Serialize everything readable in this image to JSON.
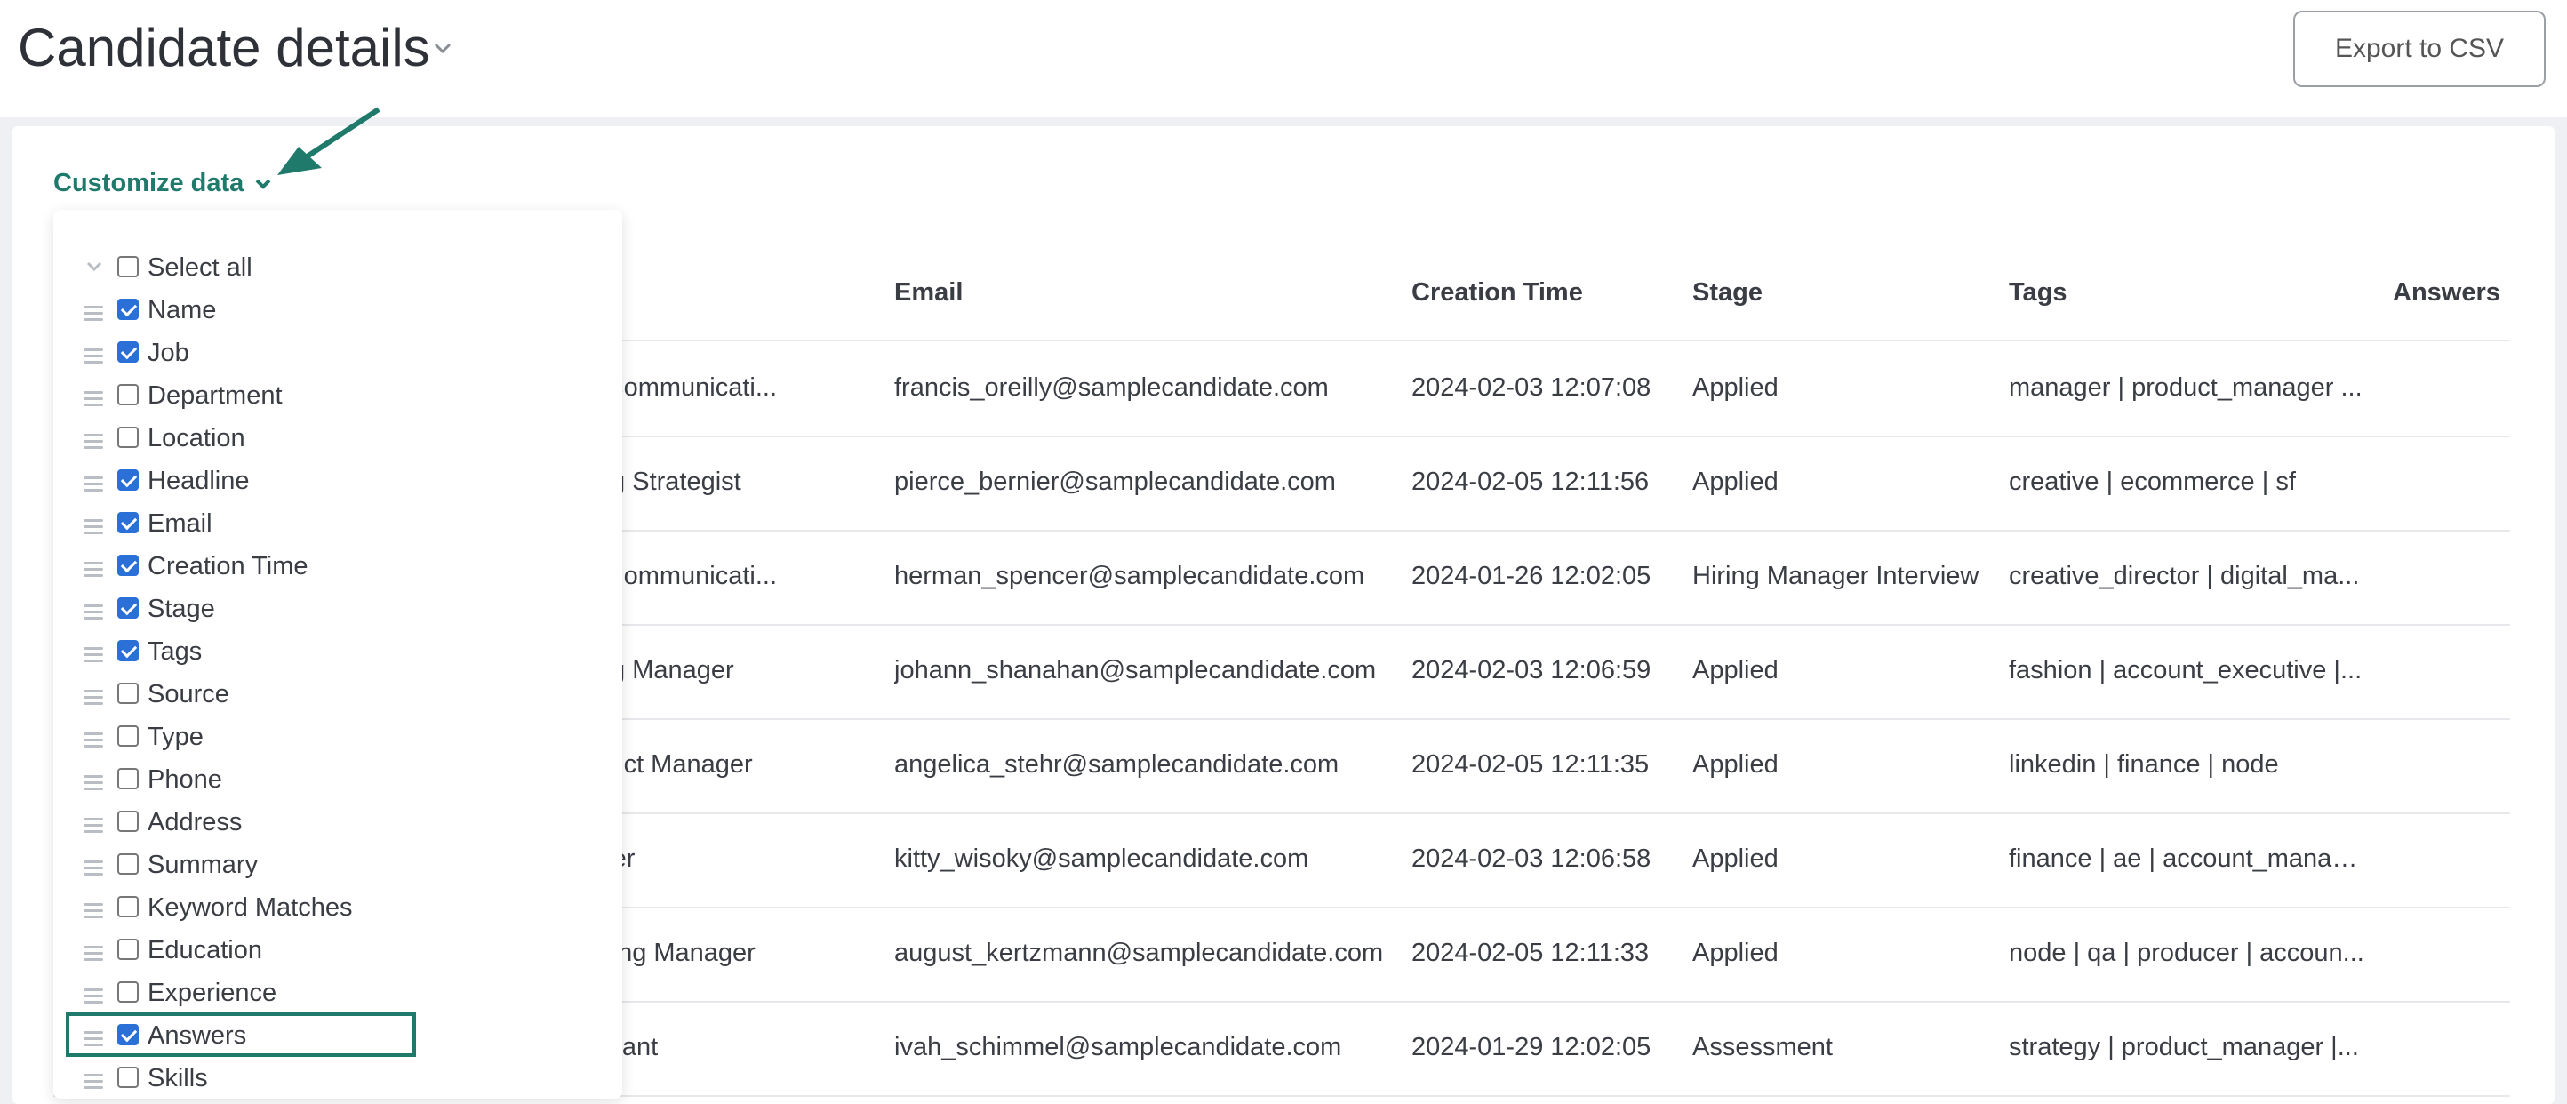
{
  "header": {
    "title": "Candidate details",
    "export_label": "Export to CSV"
  },
  "customize": {
    "label": "Customize data"
  },
  "columns": [
    "Email",
    "Creation Time",
    "Stage",
    "Tags",
    "Answers"
  ],
  "rows": [
    {
      "job": "g and Communicati...",
      "email": "francis_oreilly@samplecandidate.com",
      "time": "2024-02-03 12:07:08",
      "stage": "Applied",
      "tags": "manager | product_manager ..."
    },
    {
      "job": "arketing Strategist",
      "email": "pierce_bernier@samplecandidate.com",
      "time": "2024-02-05 12:11:56",
      "stage": "Applied",
      "tags": "creative | ecommerce | sf"
    },
    {
      "job": "g and Communicati...",
      "email": "herman_spencer@samplecandidate.com",
      "time": "2024-01-26 12:02:05",
      "stage": "Hiring Manager Interview",
      "tags": "creative_director | digital_ma..."
    },
    {
      "job": "arketing Manager",
      "email": "johann_shanahan@samplecandidate.com",
      "time": "2024-02-03 12:06:59",
      "stage": "Applied",
      "tags": "fashion | account_executive |..."
    },
    {
      "job": "g Product Manager",
      "email": "angelica_stehr@samplecandidate.com",
      "time": "2024-02-05 12:11:35",
      "stage": "Applied",
      "tags": "linkedin | finance | node"
    },
    {
      "job": "Manager",
      "email": "kitty_wisoky@samplecandidate.com",
      "time": "2024-02-03 12:06:58",
      "stage": "Applied",
      "tags": "finance | ae | account_manag..."
    },
    {
      "job": "Marketing Manager",
      "email": "august_kertzmann@samplecandidate.com",
      "time": "2024-02-05 12:11:33",
      "stage": "Applied",
      "tags": "node | qa | producer | accoun..."
    },
    {
      "job": "g Assistant",
      "email": "ivah_schimmel@samplecandidate.com",
      "time": "2024-01-29 12:02:05",
      "stage": "Assessment",
      "tags": "strategy | product_manager |..."
    }
  ],
  "options": [
    {
      "label": "Select all",
      "checked": false
    },
    {
      "label": "Name",
      "checked": true
    },
    {
      "label": "Job",
      "checked": true
    },
    {
      "label": "Department",
      "checked": false
    },
    {
      "label": "Location",
      "checked": false
    },
    {
      "label": "Headline",
      "checked": true
    },
    {
      "label": "Email",
      "checked": true
    },
    {
      "label": "Creation Time",
      "checked": true
    },
    {
      "label": "Stage",
      "checked": true
    },
    {
      "label": "Tags",
      "checked": true
    },
    {
      "label": "Source",
      "checked": false
    },
    {
      "label": "Type",
      "checked": false
    },
    {
      "label": "Phone",
      "checked": false
    },
    {
      "label": "Address",
      "checked": false
    },
    {
      "label": "Summary",
      "checked": false
    },
    {
      "label": "Keyword Matches",
      "checked": false
    },
    {
      "label": "Education",
      "checked": false
    },
    {
      "label": "Experience",
      "checked": false
    },
    {
      "label": "Answers",
      "checked": true
    },
    {
      "label": "Skills",
      "checked": false
    }
  ],
  "colors": {
    "accent": "#1f7a6b",
    "checkbox": "#2a70d6"
  }
}
